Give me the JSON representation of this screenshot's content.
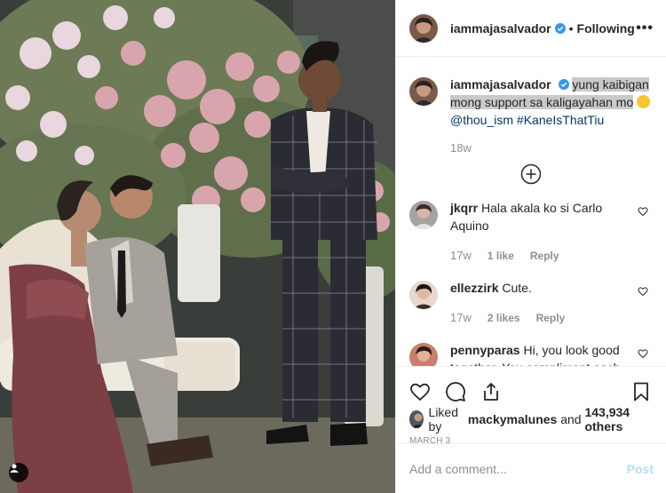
{
  "post": {
    "author": "iammajasalvador",
    "follow_state": "Following",
    "more_label": "•••",
    "separator": "•"
  },
  "caption": {
    "username": "iammajasalvador",
    "text_highlighted": "yung kaibigan mong support sa kaligayahan mo",
    "mention": "@thou_ism",
    "hashtag": "#KaneIsThatTiu",
    "time": "18w"
  },
  "comments": [
    {
      "username": "jkqrr",
      "text": "Hala akala ko si Carlo Aquino",
      "time": "17w",
      "likes": "1 like",
      "reply": "Reply"
    },
    {
      "username": "ellezzirk",
      "text": "Cute.",
      "time": "17w",
      "likes": "2 likes",
      "reply": "Reply"
    },
    {
      "username": "pennyparas",
      "text": "Hi, you look good together. You compliment each",
      "time": "",
      "likes": "",
      "reply": ""
    }
  ],
  "likes": {
    "prefix": "Liked by",
    "user": "mackymalunes",
    "connector": "and",
    "others": "143,934 others"
  },
  "date": "MARCH 3",
  "add_comment": {
    "placeholder": "Add a comment...",
    "post_label": "Post"
  },
  "icons": {
    "heart": "heart-icon",
    "comment": "comment-icon",
    "share": "share-icon",
    "save": "bookmark-icon",
    "load_more": "plus-circle-icon",
    "verified": "verified-badge-icon",
    "tag": "user-tag-icon"
  },
  "colors": {
    "verified_blue": "#3897f0",
    "link_blue": "#00376b",
    "post_disabled": "#b2dffc",
    "meta_grey": "#8e8e8e",
    "highlight": "#c9c9c9"
  }
}
